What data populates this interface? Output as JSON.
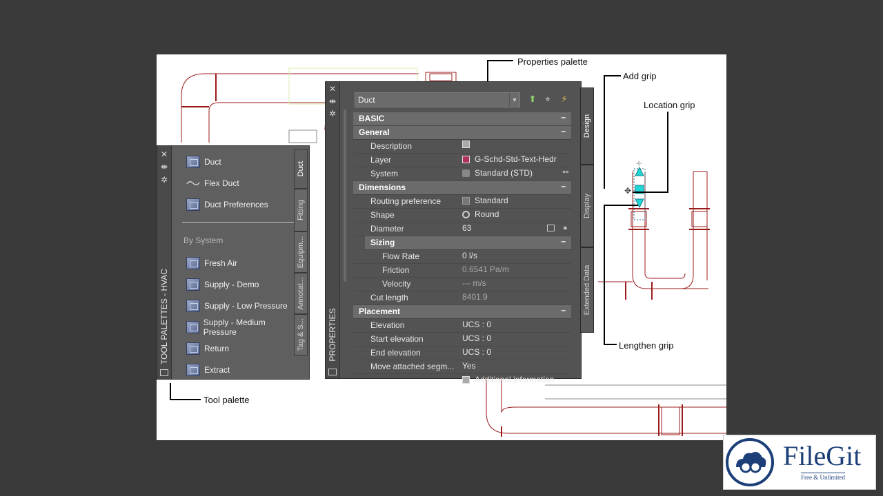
{
  "callouts": {
    "properties_palette": "Properties palette",
    "add_grip": "Add grip",
    "location_grip": "Location grip",
    "lengthen_grip": "Lengthen grip",
    "tool_palette": "Tool palette"
  },
  "tool_palette": {
    "title": "TOOL PALETTES - HVAC",
    "items": [
      "Duct",
      "Flex Duct",
      "Duct Preferences"
    ],
    "section": "By System",
    "system_items": [
      "Fresh Air",
      "Supply - Demo",
      "Supply - Low Pressure",
      "Supply - Medium Pressure",
      "Return",
      "Extract"
    ],
    "tabs": [
      "Duct",
      "Fitting",
      "Equipm...",
      "Annotat...",
      "Tag & S..."
    ]
  },
  "properties": {
    "title": "PROPERTIES",
    "selected": "Duct",
    "tabs": [
      "Design",
      "Display",
      "Extended Data"
    ],
    "categories": {
      "basic": "BASIC",
      "general": "General",
      "dimensions": "Dimensions",
      "sizing": "Sizing",
      "placement": "Placement"
    },
    "general": [
      {
        "label": "Description",
        "value": ""
      },
      {
        "label": "Layer",
        "value": "G-Schd-Std-Text-Hedr"
      },
      {
        "label": "System",
        "value": "Standard (STD)"
      }
    ],
    "dimensions": [
      {
        "label": "Routing preference",
        "value": "Standard"
      },
      {
        "label": "Shape",
        "value": "Round"
      },
      {
        "label": "Diameter",
        "value": "63"
      }
    ],
    "sizing": [
      {
        "label": "Flow Rate",
        "value": "0 l/s"
      },
      {
        "label": "Friction",
        "value": "0.6541 Pa/m"
      },
      {
        "label": "Velocity",
        "value": "--- m/s"
      }
    ],
    "cut_length": {
      "label": "Cut length",
      "value": "8401.9"
    },
    "placement": [
      {
        "label": "Elevation",
        "value": "UCS : 0"
      },
      {
        "label": "Start elevation",
        "value": "UCS : 0"
      },
      {
        "label": "End elevation",
        "value": "UCS : 0"
      },
      {
        "label": "Move attached segm...",
        "value": "Yes"
      }
    ],
    "additional": "Additional information"
  },
  "logo": {
    "name": "FileGit",
    "tagline": "Free & Unlimited"
  },
  "colors": {
    "accent_grip": "#21d6d6",
    "duct_line": "#9b1b1b",
    "layer_swatch": "#b03060"
  }
}
